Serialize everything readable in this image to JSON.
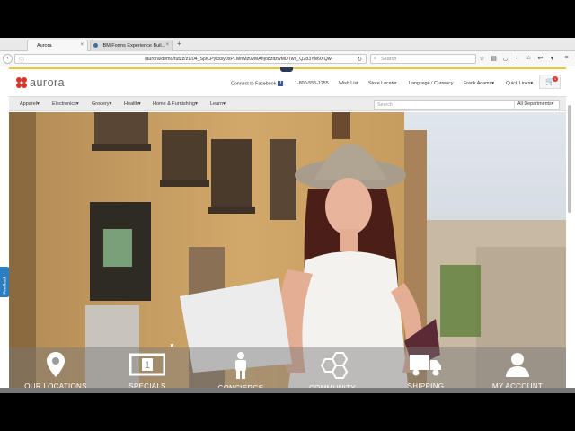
{
  "browser": {
    "tabs": [
      {
        "label": "Aurora",
        "active": true
      },
      {
        "label": "IBM Forms Experience Buil...",
        "active": false
      }
    ],
    "url": "/aurora/demo/tutzz/z1/04_Sj9CPykssy0xPLMnMz0vMAfIjo8zitzwMDTws_Q283YM9XQw-",
    "search_placeholder": "Search"
  },
  "site": {
    "logo_text": "aurora",
    "header_links": {
      "facebook": "Connect to Facebook",
      "phone": "1-800-555-1255",
      "wishlist": "Wish List",
      "store_locator": "Store Locator",
      "language": "Language / Currency",
      "user": "Frank Adams",
      "quick_links": "Quick Links"
    },
    "cart_count": "1",
    "categories": [
      "Apparel",
      "Electronics",
      "Grocery",
      "Health",
      "Home & Furnishing",
      "Learn"
    ],
    "search_placeholder": "Search",
    "department": "All Departments"
  },
  "hero": {
    "icons": [
      {
        "label": "OUR LOCATIONS",
        "icon": "location-pin-icon"
      },
      {
        "label": "SPECIALS",
        "icon": "dollar-bill-icon"
      },
      {
        "label": "CONCIERGE",
        "icon": "person-icon"
      },
      {
        "label": "COMMUNITY",
        "icon": "hexagon-network-icon"
      },
      {
        "label": "SHIPPING",
        "icon": "truck-icon"
      },
      {
        "label": "MY ACCOUNT",
        "icon": "user-account-icon"
      }
    ]
  },
  "feedback_label": "Feedback",
  "colors": {
    "accent": "#f2c530",
    "brand_red": "#d9342b"
  }
}
